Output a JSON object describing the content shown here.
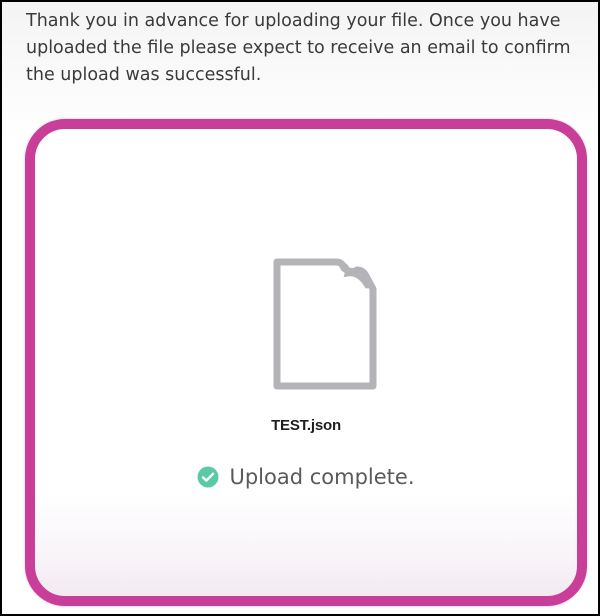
{
  "intro": {
    "text": "Thank you in advance for uploading your file. Once you have uploaded the file please expect to receive an email to confirm the upload was successful."
  },
  "upload": {
    "file_icon": "document-icon",
    "file_name": "TEST.json",
    "status_icon": "check-circle-icon",
    "status_text": "Upload complete."
  },
  "colors": {
    "border_accent": "#c83e98",
    "success": "#5cc9a6",
    "file_icon": "#b3b3b8"
  }
}
